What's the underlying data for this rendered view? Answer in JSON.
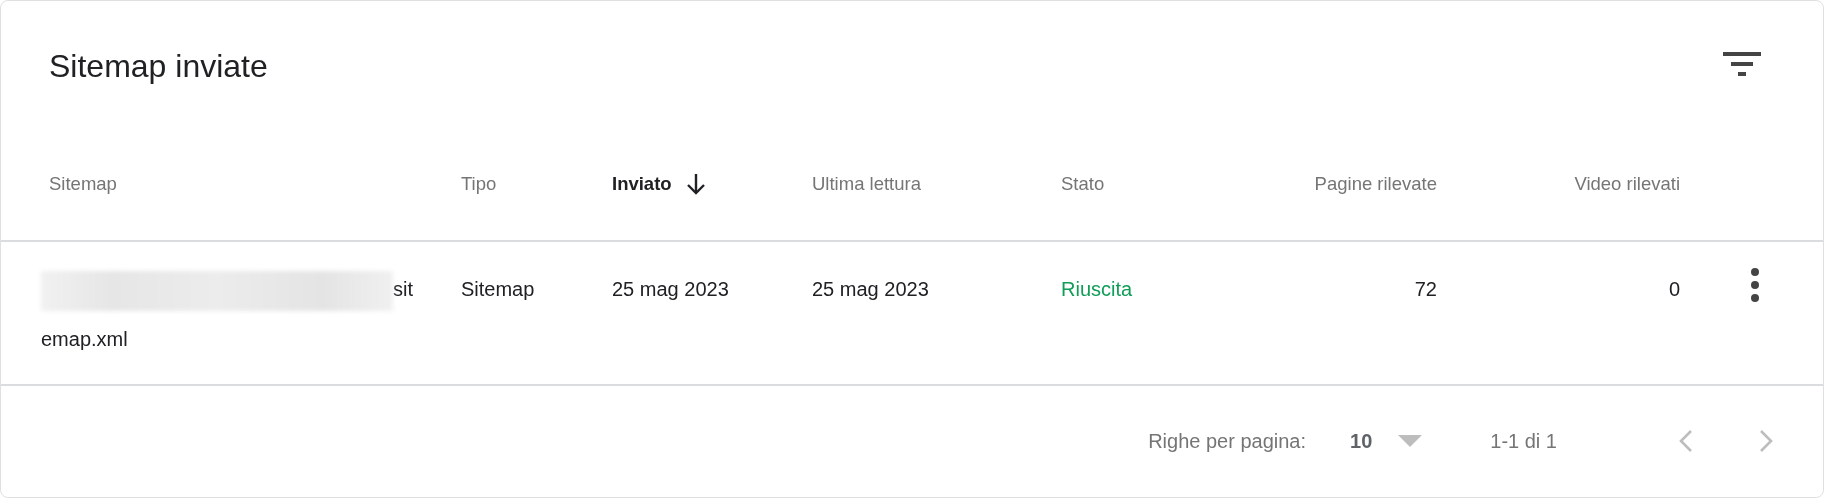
{
  "card": {
    "title": "Sitemap inviate"
  },
  "table": {
    "columns": [
      {
        "label": "Sitemap",
        "sorted": false
      },
      {
        "label": "Tipo",
        "sorted": false
      },
      {
        "label": "Inviato",
        "sorted": true
      },
      {
        "label": "Ultima lettura",
        "sorted": false
      },
      {
        "label": "Stato",
        "sorted": false
      },
      {
        "label": "Pagine rilevate",
        "sorted": false
      },
      {
        "label": "Video rilevati",
        "sorted": false
      }
    ],
    "rows": [
      {
        "sitemap": "sitemap.xml",
        "type": "Sitemap",
        "submitted": "25 mag 2023",
        "last_read": "25 mag 2023",
        "status": {
          "text": "Riuscita",
          "kind": "success"
        },
        "pages": "72",
        "videos": "0"
      }
    ]
  },
  "pagination": {
    "rows_label": "Righe per pagina:",
    "rows_value": "10",
    "range": "1-1 di 1",
    "prev_disabled": true,
    "next_disabled": true
  }
}
